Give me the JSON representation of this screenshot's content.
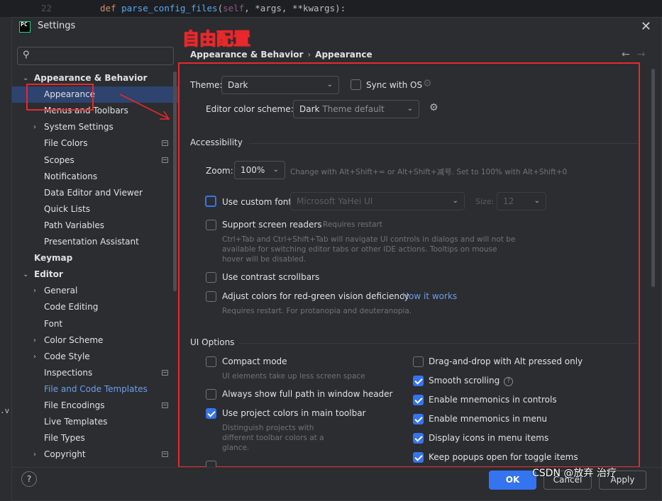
{
  "editor": {
    "line_number": "22",
    "code_kw": "def ",
    "code_fn": "parse_config_files",
    "code_rest_open": "(",
    "code_self": "self",
    "code_rest": ", *args, **kwargs):",
    "fragment": ".v"
  },
  "dialog": {
    "app_icon_text": "PC",
    "title": "Settings",
    "close_glyph": "✕"
  },
  "annotation": "自由配置",
  "search": {
    "value": "",
    "placeholder": "",
    "icon": "search-icon"
  },
  "tree": [
    {
      "label": "Appearance & Behavior",
      "bold": true,
      "chevron": "expanded",
      "level": 0
    },
    {
      "label": "Appearance",
      "selected": true,
      "level": 1
    },
    {
      "label": "Menus and Toolbars",
      "level": 1
    },
    {
      "label": "System Settings",
      "chevron": "collapsed",
      "level": 1
    },
    {
      "label": "File Colors",
      "badge": true,
      "level": 1
    },
    {
      "label": "Scopes",
      "badge": true,
      "level": 1
    },
    {
      "label": "Notifications",
      "level": 1
    },
    {
      "label": "Data Editor and Viewer",
      "level": 1
    },
    {
      "label": "Quick Lists",
      "level": 1
    },
    {
      "label": "Path Variables",
      "level": 1
    },
    {
      "label": "Presentation Assistant",
      "level": 1
    },
    {
      "label": "Keymap",
      "bold": true,
      "level": 0
    },
    {
      "label": "Editor",
      "bold": true,
      "chevron": "expanded",
      "level": 0
    },
    {
      "label": "General",
      "chevron": "collapsed",
      "level": 1
    },
    {
      "label": "Code Editing",
      "level": 1
    },
    {
      "label": "Font",
      "level": 1
    },
    {
      "label": "Color Scheme",
      "chevron": "collapsed",
      "level": 1
    },
    {
      "label": "Code Style",
      "chevron": "collapsed",
      "level": 1
    },
    {
      "label": "Inspections",
      "badge": true,
      "level": 1
    },
    {
      "label": "File and Code Templates",
      "link": true,
      "level": 1
    },
    {
      "label": "File Encodings",
      "badge": true,
      "level": 1
    },
    {
      "label": "Live Templates",
      "level": 1
    },
    {
      "label": "File Types",
      "level": 1
    },
    {
      "label": "Copyright",
      "chevron": "collapsed",
      "badge": true,
      "level": 1
    }
  ],
  "breadcrumb": {
    "parent": "Appearance & Behavior",
    "separator": "›",
    "current": "Appearance"
  },
  "nav": {
    "back": "←",
    "forward": "→"
  },
  "theme": {
    "label": "Theme:",
    "value": "Dark",
    "sync_label": "Sync with OS"
  },
  "color_scheme": {
    "label": "Editor color scheme:",
    "value": "Dark",
    "suffix": "Theme default"
  },
  "accessibility": {
    "title": "Accessibility",
    "zoom_label": "Zoom:",
    "zoom_value": "100%",
    "zoom_hint": "Change with Alt+Shift+= or Alt+Shift+减号. Set to 100% with Alt+Shift+0",
    "custom_font_label": "Use custom font:",
    "custom_font_value": "Microsoft YaHei UI",
    "size_label": "Size:",
    "size_value": "12",
    "screen_readers_label": "Support screen readers",
    "screen_readers_hint": "Requires restart",
    "screen_readers_desc": [
      "Ctrl+Tab and Ctrl+Shift+Tab will navigate UI controls in dialogs and will not be",
      "available for switching editor tabs or other IDE actions. Tooltips on mouse",
      "hover will be disabled."
    ],
    "contrast_label": "Use contrast scrollbars",
    "redgreen_label": "Adjust colors for red-green vision deficiency",
    "redgreen_link": "How it works",
    "redgreen_desc": "Requires restart. For protanopia and deuteranopia."
  },
  "ui_options": {
    "title": "UI Options",
    "compact_label": "Compact mode",
    "compact_desc": "UI elements take up less screen space",
    "full_path_label": "Always show full path in window header",
    "project_colors_label": "Use project colors in main toolbar",
    "project_colors_desc": [
      "Distinguish projects with",
      "different toolbar colors at a",
      "glance."
    ],
    "drag_drop_label": "Drag-and-drop with Alt pressed only",
    "smooth_label": "Smooth scrolling",
    "mnemonics_controls_label": "Enable mnemonics in controls",
    "mnemonics_menu_label": "Enable mnemonics in menu",
    "display_icons_label": "Display icons in menu items",
    "keep_popups_label": "Keep popups open for toggle items"
  },
  "footer": {
    "help": "?",
    "ok": "OK",
    "cancel": "Cancel",
    "apply": "Apply"
  },
  "watermark": "CSDN @放弃      治疗",
  "colors": {
    "accent": "#3574f0",
    "annotation_red": "#e8282b",
    "dialog_bg": "#2b2d30",
    "selection": "#2e436e",
    "link": "#6d9eeb"
  }
}
